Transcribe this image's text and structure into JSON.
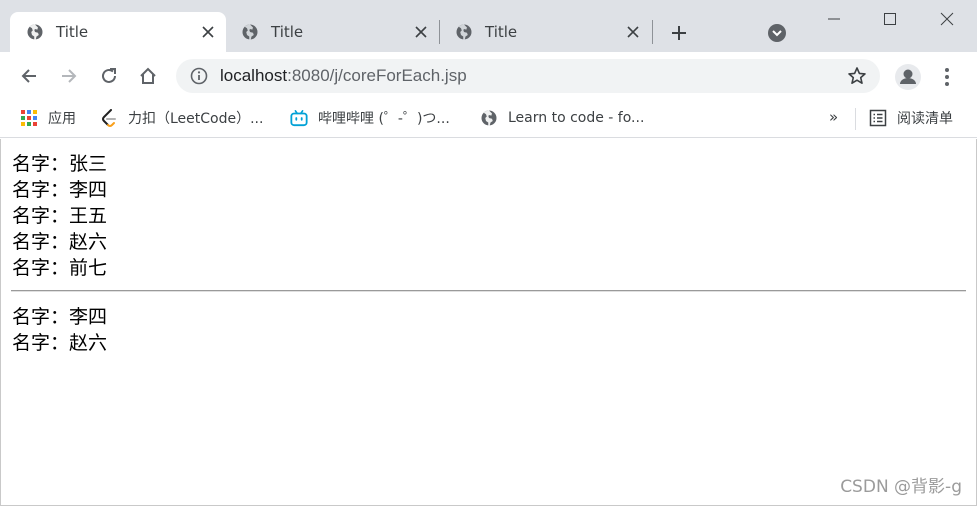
{
  "tabs": [
    {
      "title": "Title",
      "active": true
    },
    {
      "title": "Title",
      "active": false
    },
    {
      "title": "Title",
      "active": false
    }
  ],
  "toolbar": {
    "url_host": "localhost",
    "url_path": ":8080/j/coreForEach.jsp"
  },
  "bookmarks": {
    "items": [
      {
        "label": "应用",
        "icon": "apps-grid-icon"
      },
      {
        "label": "力扣（LeetCode）...",
        "icon": "leetcode-icon"
      },
      {
        "label": "哔哩哔哩 (゜-゜)つ...",
        "icon": "bilibili-icon"
      },
      {
        "label": "Learn to code - fo...",
        "icon": "globe-icon"
      }
    ],
    "more": "»",
    "reading_list": "阅读清单"
  },
  "content": {
    "all_names": [
      "名字：张三",
      "名字：李四",
      "名字：王五",
      "名字：赵六",
      "名字：前七"
    ],
    "filtered_names": [
      "名字：李四",
      "名字：赵六"
    ]
  },
  "watermark": "CSDN @背影-g",
  "colors": {
    "tabstrip": "#dee1e6",
    "omnibox": "#f1f3f4",
    "icon": "#5f6368"
  }
}
